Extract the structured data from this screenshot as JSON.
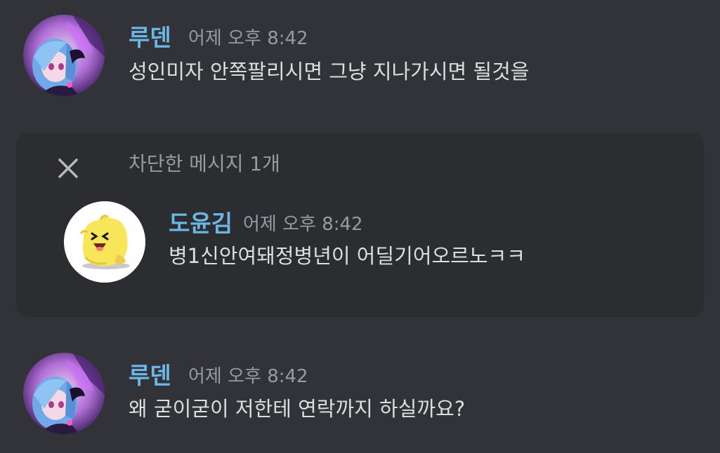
{
  "messages": [
    {
      "username": "루덴",
      "timestamp": "어제 오후 8:42",
      "text": "성인미자 안쪽팔리시면 그냥 지나가시면 될것을",
      "avatar_icon": "anime-character-avatar",
      "name_color": "#6cb6e6"
    },
    {
      "username": "루덴",
      "timestamp": "어제 오후 8:42",
      "text": "왜 굳이굳이 저한테 연락까지 하실까요?",
      "avatar_icon": "anime-character-avatar",
      "name_color": "#6cb6e6"
    }
  ],
  "blocked": {
    "label": "차단한 메시지 1개",
    "close_icon": "close-icon",
    "message": {
      "username": "도윤김",
      "timestamp": "어제 오후 8:42",
      "text": "병1신안여돼정병년이 어딜기어오르노ㅋㅋ",
      "avatar_icon": "yellow-creature-avatar",
      "name_color": "#6cb6e6"
    }
  },
  "colors": {
    "background": "#313338",
    "blocked_background": "#2b2d31",
    "text": "#dbdee1",
    "muted": "#949ba4"
  }
}
